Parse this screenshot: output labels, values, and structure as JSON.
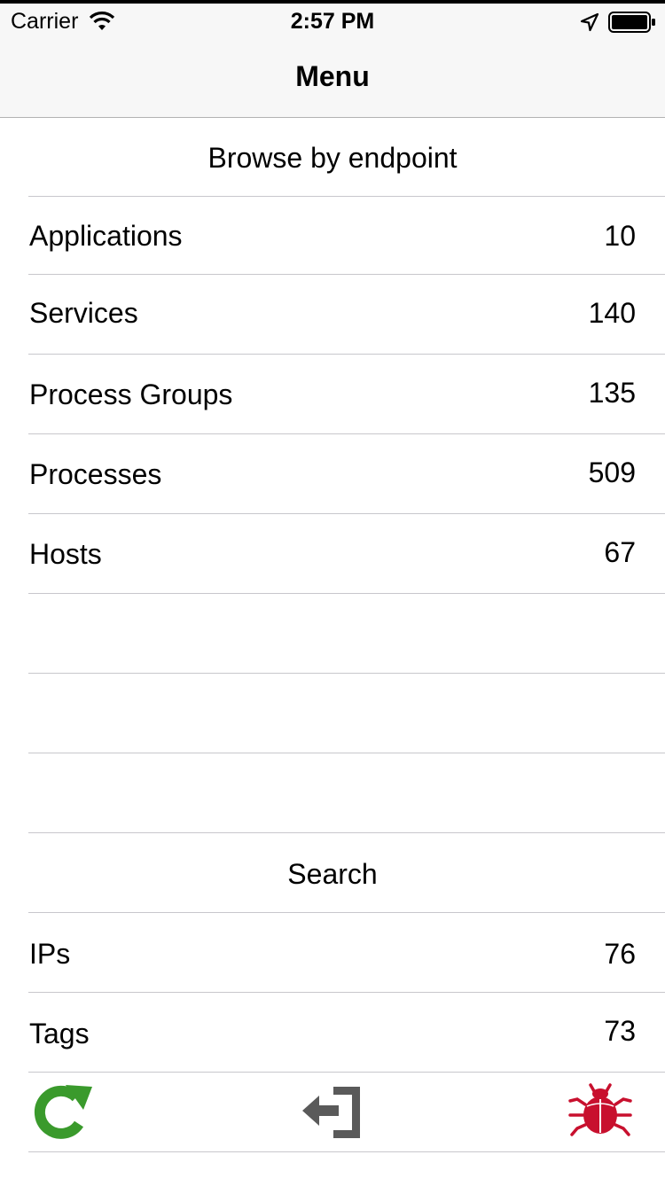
{
  "status_bar": {
    "carrier": "Carrier",
    "time": "2:57 PM"
  },
  "nav": {
    "title": "Menu"
  },
  "browse_section": {
    "title": "Browse by endpoint"
  },
  "endpoints": [
    {
      "label": "Applications",
      "count": "10"
    },
    {
      "label": "Services",
      "count": "140"
    },
    {
      "label": "Process Groups",
      "count": "135"
    },
    {
      "label": "Processes",
      "count": "509"
    },
    {
      "label": "Hosts",
      "count": "67"
    }
  ],
  "search_section": {
    "title": "Search"
  },
  "search_items": [
    {
      "label": "IPs",
      "count": "76"
    },
    {
      "label": "Tags",
      "count": "73"
    }
  ],
  "toolbar": {
    "icons": [
      "refresh-icon",
      "logout-icon",
      "bug-icon"
    ],
    "colors": {
      "refresh": "#3a9a2c",
      "logout": "#5a5a5a",
      "bug": "#c8102e"
    }
  }
}
